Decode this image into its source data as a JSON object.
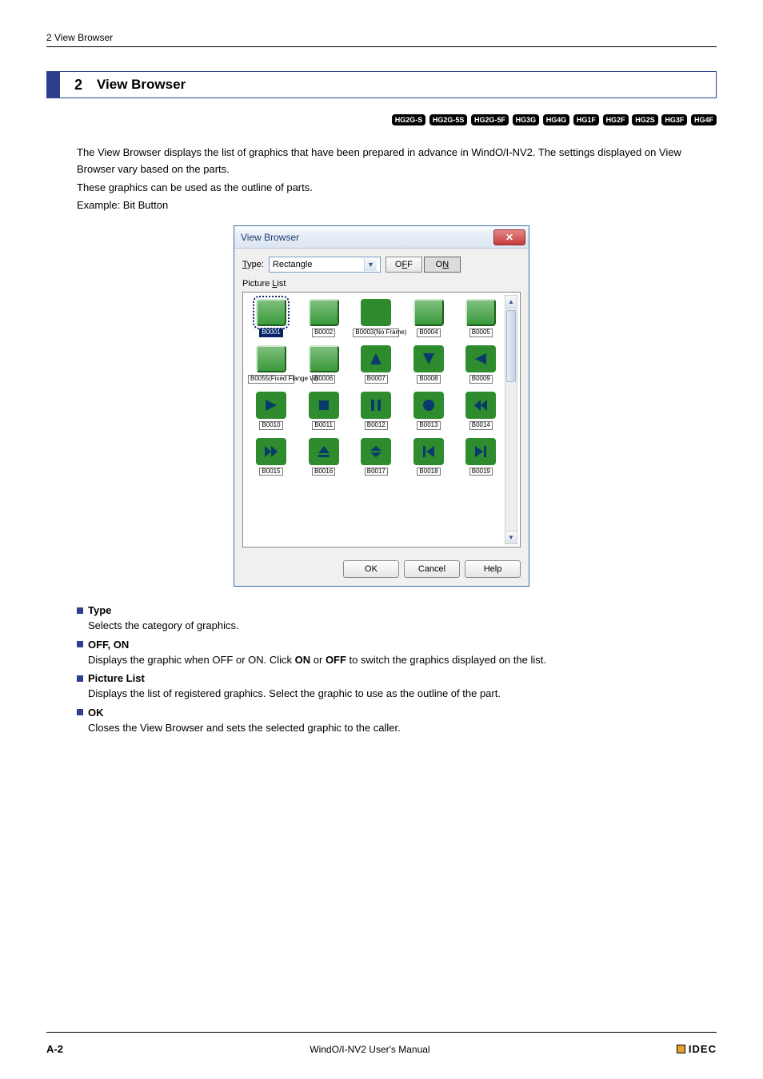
{
  "header": {
    "breadcrumb": "2 View Browser"
  },
  "section": {
    "number": "2",
    "title": "View Browser"
  },
  "badges": [
    "HG2G-S",
    "HG2G-5S",
    "HG2G-5F",
    "HG3G",
    "HG4G",
    "HG1F",
    "HG2F",
    "HG2S",
    "HG3F",
    "HG4F"
  ],
  "intro": {
    "p1": "The View Browser displays the list of graphics that have been prepared in advance in WindO/I-NV2. The settings displayed on View Browser vary based on the parts.",
    "p2": "These graphics can be used as the outline of parts.",
    "p3": "Example: Bit Button"
  },
  "dialog": {
    "title": "View Browser",
    "type_label": "Type:",
    "type_value": "Rectangle",
    "off_label": "OFF",
    "on_label": "ON",
    "picture_list_label": "Picture List",
    "items": [
      {
        "label": "B0001",
        "icon": "blank",
        "style": "btn3d",
        "selected": true
      },
      {
        "label": "B0002",
        "icon": "blank",
        "style": "btn3d"
      },
      {
        "label": "B0003(No Frame)",
        "icon": "blank",
        "style": "flat"
      },
      {
        "label": "B0004",
        "icon": "blank",
        "style": "btn3d"
      },
      {
        "label": "B0005",
        "icon": "blank",
        "style": "btn3d"
      },
      {
        "label": "B0055(Fixed Flange W)",
        "icon": "blank",
        "style": "btn3d"
      },
      {
        "label": "B0006",
        "icon": "blank",
        "style": "btn3d"
      },
      {
        "label": "B0007",
        "icon": "tri-up",
        "style": "flat"
      },
      {
        "label": "B0008",
        "icon": "tri-down",
        "style": "flat"
      },
      {
        "label": "B0009",
        "icon": "tri-left",
        "style": "flat"
      },
      {
        "label": "B0010",
        "icon": "tri-right",
        "style": "flat"
      },
      {
        "label": "B0011",
        "icon": "square",
        "style": "flat"
      },
      {
        "label": "B0012",
        "icon": "pause",
        "style": "flat"
      },
      {
        "label": "B0013",
        "icon": "circle",
        "style": "flat"
      },
      {
        "label": "B0014",
        "icon": "rewind",
        "style": "flat"
      },
      {
        "label": "B0015",
        "icon": "ffwd",
        "style": "flat"
      },
      {
        "label": "B0016",
        "icon": "eject",
        "style": "flat"
      },
      {
        "label": "B0017",
        "icon": "dbl-bar",
        "style": "flat"
      },
      {
        "label": "B0018",
        "icon": "skip-prev",
        "style": "flat"
      },
      {
        "label": "B0019",
        "icon": "skip-next",
        "style": "flat"
      }
    ],
    "ok": "OK",
    "cancel": "Cancel",
    "help": "Help"
  },
  "descriptions": [
    {
      "title": "Type",
      "body": "Selects the category of graphics."
    },
    {
      "title": "OFF, ON",
      "body_pre": "Displays the graphic when OFF or ON. Click ",
      "body_b1": "ON",
      "body_mid": " or ",
      "body_b2": "OFF",
      "body_post": " to switch the graphics displayed on the list."
    },
    {
      "title": "Picture List",
      "body": "Displays the list of registered graphics. Select the graphic to use as the outline of the part."
    },
    {
      "title": "OK",
      "body": "Closes the View Browser and sets the selected graphic to the caller."
    }
  ],
  "footer": {
    "page": "A-2",
    "manual": "WindO/I-NV2 User's Manual",
    "brand": "IDEC"
  }
}
